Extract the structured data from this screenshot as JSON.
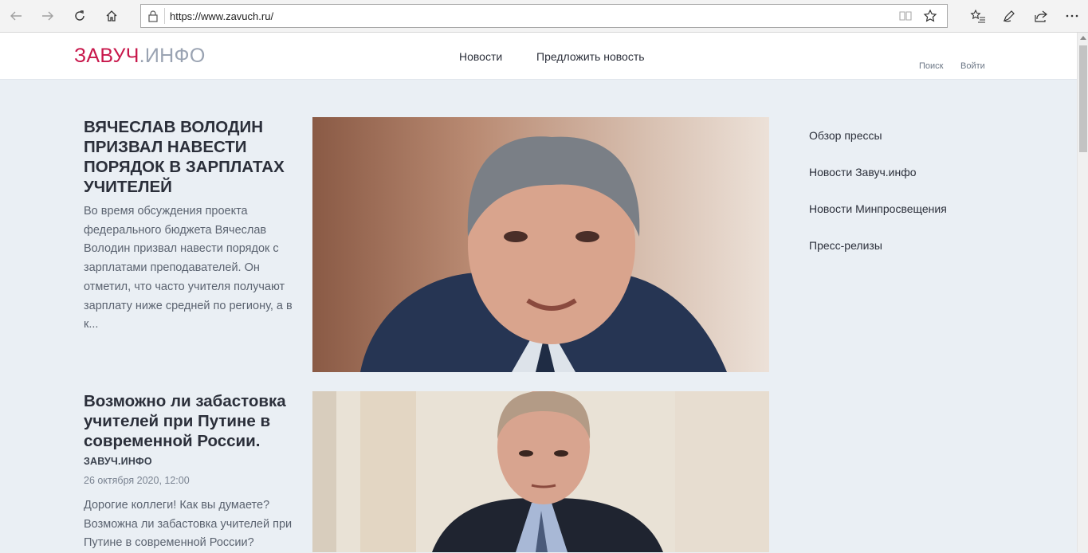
{
  "browser": {
    "url": "https://www.zavuch.ru/"
  },
  "site": {
    "logo_part1": "ЗАВУЧ",
    "logo_part2": ".ИНФО",
    "nav": [
      "Новости",
      "Предложить новость"
    ],
    "search_label": "Поиск",
    "login_label": "Войти"
  },
  "articles": [
    {
      "title": "ВЯЧЕСЛАВ ВОЛОДИН ПРИЗВАЛ НАВЕСТИ ПОРЯДОК В ЗАРПЛАТАХ УЧИТЕЛЕЙ",
      "excerpt": "Во время обсуждения проекта федерального бюджета Вячеслав Володин призвал навести порядок с зарплатами преподавателей. Он отметил, что часто учителя получают зарплату ниже средней по региону, а в к..."
    },
    {
      "title": "Возможно ли забастовка учителей при Путине в современной России.",
      "source": "ЗАВУЧ.ИНФО",
      "date": "26 октября 2020, 12:00",
      "excerpt": "Дорогие коллеги! Как вы думаете? Возможна ли забастовка учителей при Путине в современной России?"
    }
  ],
  "sidebar": {
    "links": [
      "Обзор прессы",
      "Новости Завуч.инфо",
      "Новости Минпросвещения",
      "Пресс-релизы"
    ]
  }
}
